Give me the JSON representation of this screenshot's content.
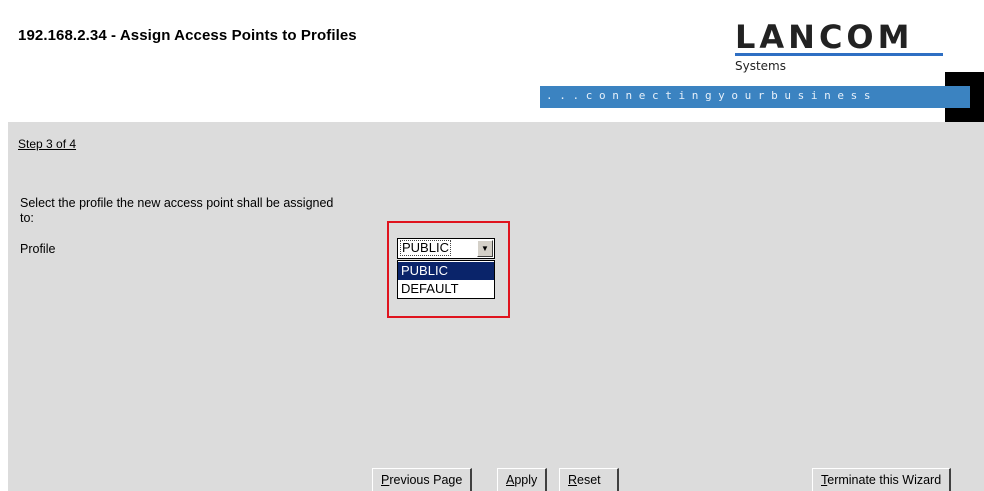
{
  "header": {
    "title": "192.168.2.34 - Assign Access Points to Profiles",
    "logo": {
      "word": "LANCOM",
      "sub": "Systems"
    },
    "tagline": ". . .   c o n n e c t i n g   y o u r   b u s i n e s s",
    "colors": {
      "tagline_bar": "#3b83c1",
      "logo_line": "#2e6fc3"
    }
  },
  "main": {
    "step": "Step 3 of 4",
    "instruction": "Select the profile the new access point shall be assigned to:",
    "profile_label": "Profile",
    "profile_select": {
      "selected": "PUBLIC",
      "options": [
        "PUBLIC",
        "DEFAULT"
      ],
      "highlighted_option": "PUBLIC",
      "expanded": true,
      "arrow_icon": "chevron-down-icon"
    },
    "highlight_color": "#e0141e",
    "background": "#dcdcdc"
  },
  "footer": {
    "previous": {
      "mnemonic": "P",
      "rest": "revious Page"
    },
    "apply": {
      "mnemonic": "A",
      "rest": "pply"
    },
    "reset": {
      "mnemonic": "R",
      "rest": "eset"
    },
    "terminate": {
      "mnemonic": "T",
      "rest": "erminate this Wizard"
    }
  }
}
